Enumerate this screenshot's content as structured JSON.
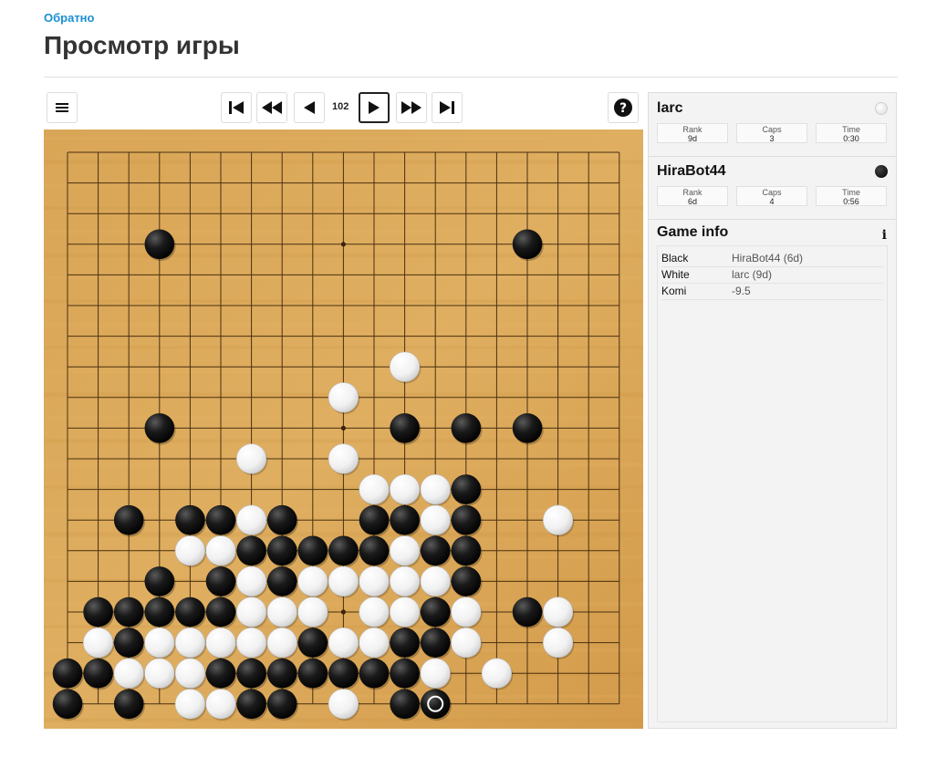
{
  "header": {
    "back_link": "Обратно",
    "title": "Просмотр игры"
  },
  "toolbar": {
    "menu_icon": "hamburger-menu-icon",
    "first_icon": "skip-to-first-icon",
    "back_fast_icon": "fast-backward-icon",
    "back_icon": "step-backward-icon",
    "move_number": "102",
    "forward_icon": "step-forward-icon",
    "forward_fast_icon": "fast-forward-icon",
    "last_icon": "skip-to-last-icon",
    "help_icon": "help-question-icon"
  },
  "board": {
    "size": 19,
    "star_points": [
      [
        9,
        3
      ],
      [
        9,
        9
      ],
      [
        9,
        15
      ]
    ],
    "black": [
      [
        3,
        3
      ],
      [
        15,
        3
      ],
      [
        3,
        9
      ],
      [
        11,
        9
      ],
      [
        13,
        9
      ],
      [
        15,
        9
      ],
      [
        13,
        11
      ],
      [
        2,
        12
      ],
      [
        4,
        12
      ],
      [
        5,
        12
      ],
      [
        7,
        12
      ],
      [
        10,
        12
      ],
      [
        11,
        12
      ],
      [
        13,
        12
      ],
      [
        6,
        13
      ],
      [
        7,
        13
      ],
      [
        8,
        13
      ],
      [
        9,
        13
      ],
      [
        10,
        13
      ],
      [
        12,
        13
      ],
      [
        13,
        13
      ],
      [
        3,
        14
      ],
      [
        5,
        14
      ],
      [
        7,
        14
      ],
      [
        13,
        14
      ],
      [
        1,
        15
      ],
      [
        2,
        15
      ],
      [
        3,
        15
      ],
      [
        4,
        15
      ],
      [
        5,
        15
      ],
      [
        12,
        15
      ],
      [
        15,
        15
      ],
      [
        2,
        16
      ],
      [
        8,
        16
      ],
      [
        11,
        16
      ],
      [
        12,
        16
      ],
      [
        0,
        17
      ],
      [
        1,
        17
      ],
      [
        5,
        17
      ],
      [
        6,
        17
      ],
      [
        7,
        17
      ],
      [
        8,
        17
      ],
      [
        9,
        17
      ],
      [
        10,
        17
      ],
      [
        11,
        17
      ],
      [
        0,
        18
      ],
      [
        2,
        18
      ],
      [
        6,
        18
      ],
      [
        7,
        18
      ],
      [
        11,
        18
      ],
      [
        12,
        18
      ]
    ],
    "white": [
      [
        11,
        7
      ],
      [
        9,
        8
      ],
      [
        6,
        10
      ],
      [
        9,
        10
      ],
      [
        10,
        11
      ],
      [
        11,
        11
      ],
      [
        12,
        11
      ],
      [
        6,
        12
      ],
      [
        12,
        12
      ],
      [
        16,
        12
      ],
      [
        4,
        13
      ],
      [
        5,
        13
      ],
      [
        11,
        13
      ],
      [
        6,
        14
      ],
      [
        8,
        14
      ],
      [
        9,
        14
      ],
      [
        10,
        14
      ],
      [
        11,
        14
      ],
      [
        12,
        14
      ],
      [
        6,
        15
      ],
      [
        7,
        15
      ],
      [
        8,
        15
      ],
      [
        10,
        15
      ],
      [
        11,
        15
      ],
      [
        13,
        15
      ],
      [
        16,
        15
      ],
      [
        1,
        16
      ],
      [
        3,
        16
      ],
      [
        4,
        16
      ],
      [
        5,
        16
      ],
      [
        6,
        16
      ],
      [
        7,
        16
      ],
      [
        9,
        16
      ],
      [
        10,
        16
      ],
      [
        13,
        16
      ],
      [
        16,
        16
      ],
      [
        2,
        17
      ],
      [
        3,
        17
      ],
      [
        4,
        17
      ],
      [
        12,
        17
      ],
      [
        14,
        17
      ],
      [
        4,
        18
      ],
      [
        5,
        18
      ],
      [
        9,
        18
      ]
    ],
    "last_move": [
      12,
      18
    ]
  },
  "players": [
    {
      "name": "larc",
      "color": "white",
      "rank_label": "Rank",
      "rank": "9d",
      "caps_label": "Caps",
      "caps": "3",
      "time_label": "Time",
      "time": "0:30"
    },
    {
      "name": "HiraBot44",
      "color": "black",
      "rank_label": "Rank",
      "rank": "6d",
      "caps_label": "Caps",
      "caps": "4",
      "time_label": "Time",
      "time": "0:56"
    }
  ],
  "game_info": {
    "title": "Game info",
    "info_icon": "info-icon",
    "rows": [
      {
        "key": "Black",
        "value": "HiraBot44 (6d)"
      },
      {
        "key": "White",
        "value": "larc (9d)"
      },
      {
        "key": "Komi",
        "value": "-9.5"
      }
    ]
  }
}
